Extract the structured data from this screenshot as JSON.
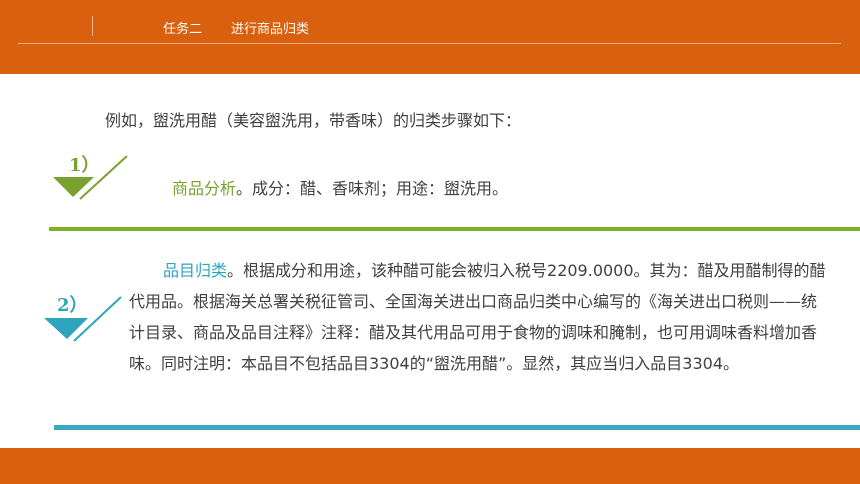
{
  "header": {
    "section": "任务二",
    "title": "进行商品归类"
  },
  "intro": "例如，盥洗用醋（美容盥洗用，带香味）的归类步骤如下：",
  "steps": [
    {
      "number": "1）",
      "heading": "商品分析",
      "body": "。成分：醋、香味剂；用途：盥洗用。",
      "color": "#78a130"
    },
    {
      "number": "2）",
      "heading": "品目归类",
      "body": "。根据成分和用途，该种醋可能会被归入税号2209.0000。其为：醋及用醋制得的醋代用品。根据海关总署关税征管司、全国海关进出口商品归类中心编写的《海关进出口税则——统计目录、商品及品目注释》注释：醋及其代用品可用于食物的调味和腌制，也可用调味香料增加香味。同时注明：本品目不包括品目3304的“盥洗用醋”。显然，其应当归入品目3304。",
      "color": "#2ea4bf"
    }
  ],
  "colors": {
    "header_bg": "#d8600f",
    "divider_green": "#7fb026",
    "divider_blue": "#3fa6c4"
  }
}
